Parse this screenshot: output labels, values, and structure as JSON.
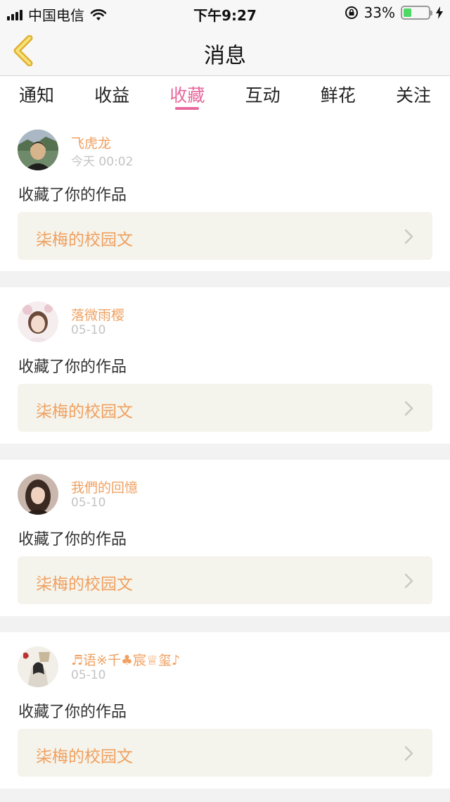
{
  "status_bar": {
    "carrier": "中国电信",
    "time": "下午9:27",
    "battery_text": "33%",
    "battery_level": 0.33
  },
  "nav": {
    "title": "消息",
    "back_icon": "chevron-left-icon"
  },
  "tabs": [
    {
      "label": "通知",
      "active": false
    },
    {
      "label": "收益",
      "active": false
    },
    {
      "label": "收藏",
      "active": true
    },
    {
      "label": "互动",
      "active": false
    },
    {
      "label": "鲜花",
      "active": false
    },
    {
      "label": "关注",
      "active": false
    }
  ],
  "colors": {
    "accent": "#e8689c",
    "username": "#f0a060",
    "link_bg": "#f4f4ec"
  },
  "items": [
    {
      "user": "飞虎龙",
      "time": "今天 00:02",
      "action": "收藏了你的作品",
      "work": "柒梅的校园文"
    },
    {
      "user": "落微雨樱",
      "time": "05-10",
      "action": "收藏了你的作品",
      "work": "柒梅的校园文"
    },
    {
      "user": "我們的回憶",
      "time": "05-10",
      "action": "收藏了你的作品",
      "work": "柒梅的校园文"
    },
    {
      "user": "♬语※千♣宸♕玺♪",
      "time": "05-10",
      "action": "收藏了你的作品",
      "work": "柒梅的校园文"
    }
  ]
}
